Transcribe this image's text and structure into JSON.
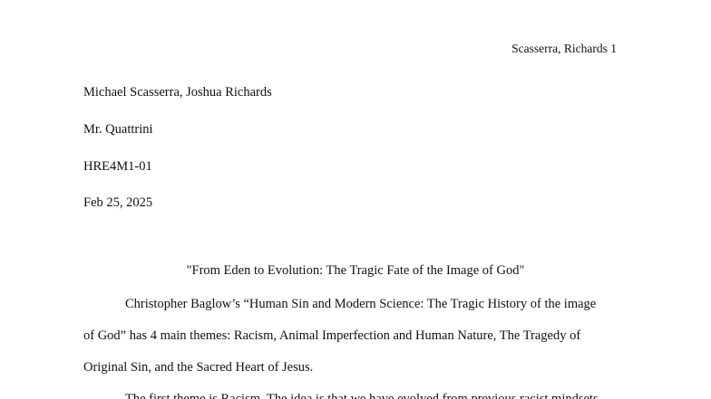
{
  "header": {
    "running_head": "Scasserra, Richards 1"
  },
  "heading": {
    "authors": "Michael Scasserra, Joshua Richards",
    "teacher": "Mr. Quattrini",
    "course": "HRE4M1-01",
    "date": "Feb 25, 2025"
  },
  "title": "\"From Eden to Evolution: The Tragic Fate of the Image of God\"",
  "body": {
    "paragraph_1": {
      "line_1": "Christopher Baglow’s “Human Sin and Modern Science: The Tragic History of the image",
      "line_2": "of God” has 4 main themes: Racism, Animal Imperfection and Human Nature, The Tragedy of",
      "line_3": "Original Sin, and the Sacred Heart of Jesus."
    },
    "paragraph_2": {
      "line_1": "The first theme is Racism. The idea is that we have evolved from previous racist mindsets"
    }
  }
}
